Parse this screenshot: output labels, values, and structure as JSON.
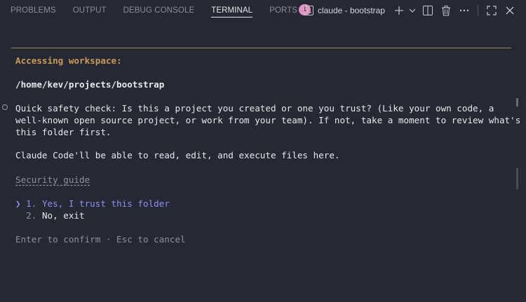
{
  "tabs": [
    {
      "label": "PROBLEMS"
    },
    {
      "label": "OUTPUT"
    },
    {
      "label": "DEBUG CONSOLE"
    },
    {
      "label": "TERMINAL"
    },
    {
      "label": "PORTS",
      "badge": "1"
    }
  ],
  "terminal_name": "claude - bootstrap",
  "icons": [
    "terminal-icon",
    "plus-icon",
    "chevron-down-icon",
    "split-icon",
    "trash-icon",
    "more-icon",
    "maximize-icon",
    "close-icon"
  ],
  "content": {
    "heading": "Accessing workspace:",
    "path": "/home/kev/projects/bootstrap",
    "check_line1": "Quick safety check: Is this a project you created or one you trust? (Like your own code, a",
    "check_line2": "well-known open source project, or work from your team). If not, take a moment to review what's in",
    "check_line3": "this folder first.",
    "ability": "Claude Code'll be able to read, edit, and execute files here.",
    "guide_link": "Security guide",
    "option1_prefix": "❯ 1.",
    "option1_text": "Yes, I trust this folder",
    "option2_prefix": "  2.",
    "option2_text": "No, exit",
    "hint": "Enter to confirm · Esc to cancel"
  },
  "colors": {
    "background": "#262833",
    "accent_gold": "#c99a5a",
    "selected": "#8c92f0",
    "badge": "#e591c4"
  }
}
